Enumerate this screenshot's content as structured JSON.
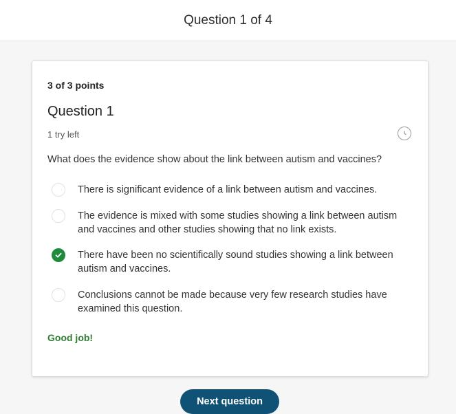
{
  "header": {
    "title": "Question 1 of 4"
  },
  "question": {
    "points": "3 of 3 points",
    "title": "Question 1",
    "tries": "1 try left",
    "history_icon": "history-icon",
    "prompt": "What does the evidence show about the link between autism and vaccines?",
    "options": [
      {
        "label": "There is significant evidence of a link between autism and vaccines.",
        "selected": false
      },
      {
        "label": "The evidence is mixed with some studies showing a link between autism and vaccines and other studies showing that no link exists.",
        "selected": false
      },
      {
        "label": "There have been no scientifically sound studies showing a link between autism and vaccines.",
        "selected": true
      },
      {
        "label": "Conclusions cannot be made because very few research studies have examined this question.",
        "selected": false
      }
    ],
    "feedback": "Good job!"
  },
  "footer": {
    "next_label": "Next question"
  },
  "colors": {
    "accent": "#0f5275",
    "correct": "#1e8a3c",
    "feedback": "#2f7d32"
  }
}
